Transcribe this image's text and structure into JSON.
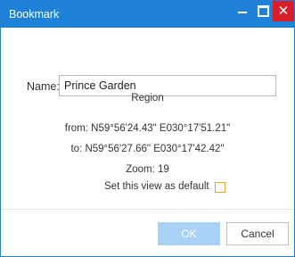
{
  "window": {
    "title": "Bookmark",
    "controls": {
      "minimize_icon": "minimize-icon",
      "maximize_icon": "maximize-icon",
      "close_icon": "close-icon",
      "close_glyph": "✕"
    },
    "colors": {
      "titlebar": "#1f82d8",
      "close_button": "#d9202a",
      "accent": "#f0a030"
    }
  },
  "form": {
    "name_label": "Name:",
    "name_value": "Prince Garden"
  },
  "region": {
    "heading": "Region",
    "from": "from: N59°56'24.43\" E030°17'51.21\"",
    "to": "to: N59°56'27.66\" E030°17'42.42\"",
    "zoom": "Zoom: 19"
  },
  "default_view": {
    "label": "Set this view as default",
    "checked": false
  },
  "buttons": {
    "ok": "OK",
    "cancel": "Cancel"
  }
}
